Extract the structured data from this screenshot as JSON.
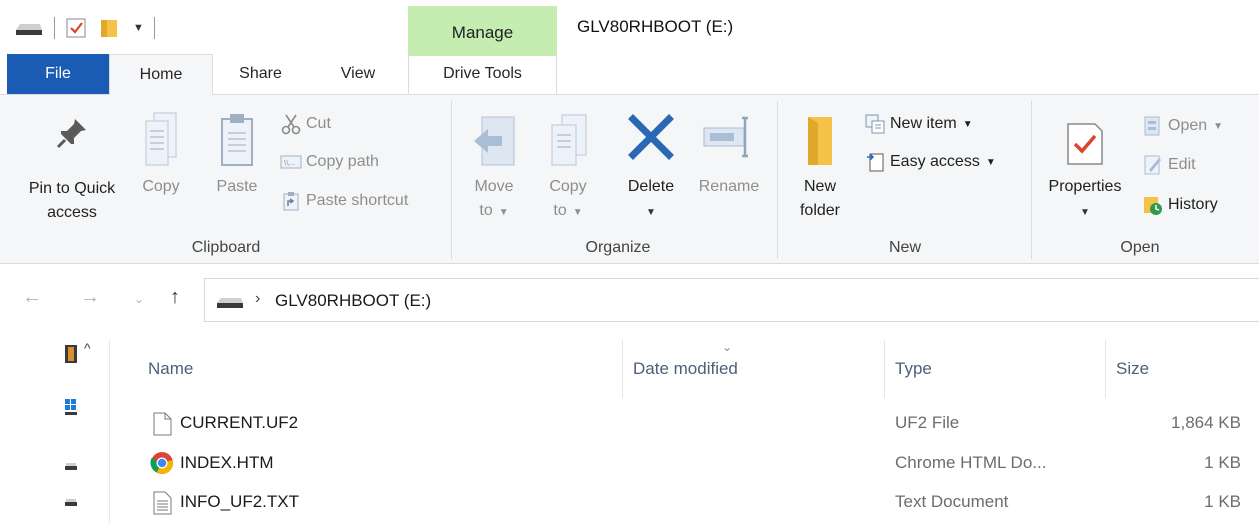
{
  "window": {
    "title": "GLV80RHBOOT (E:)",
    "contextual_tab_group": "Manage"
  },
  "tabs": {
    "file": "File",
    "home": "Home",
    "share": "Share",
    "view": "View",
    "drive_tools": "Drive Tools"
  },
  "ribbon": {
    "clipboard": {
      "label": "Clipboard",
      "pin_line1": "Pin to Quick",
      "pin_line2": "access",
      "copy": "Copy",
      "paste": "Paste",
      "cut": "Cut",
      "copy_path": "Copy path",
      "paste_shortcut": "Paste shortcut"
    },
    "organize": {
      "label": "Organize",
      "move_line1": "Move",
      "move_line2": "to",
      "copy_line1": "Copy",
      "copy_line2": "to",
      "delete": "Delete",
      "rename": "Rename"
    },
    "new": {
      "label": "New",
      "new_folder_line1": "New",
      "new_folder_line2": "folder",
      "new_item": "New item",
      "easy_access": "Easy access"
    },
    "open": {
      "label": "Open",
      "properties": "Properties",
      "open": "Open",
      "edit": "Edit",
      "history": "History"
    }
  },
  "address": {
    "path": "GLV80RHBOOT (E:)"
  },
  "columns": {
    "name": "Name",
    "date_modified": "Date modified",
    "type": "Type",
    "size": "Size"
  },
  "files": [
    {
      "name": "CURRENT.UF2",
      "type": "UF2 File",
      "size": "1,864 KB",
      "icon": "blank-file-icon"
    },
    {
      "name": "INDEX.HTM",
      "type": "Chrome HTML Do...",
      "size": "1 KB",
      "icon": "chrome-icon"
    },
    {
      "name": "INFO_UF2.TXT",
      "type": "Text Document",
      "size": "1 KB",
      "icon": "text-file-icon"
    }
  ],
  "colors": {
    "file_tab": "#1a5bb3",
    "manage_tab": "#c5ecb1",
    "ribbon_bg": "#f5f6f7",
    "delete_x": "#2a68b6",
    "folder": "#f3c247",
    "properties_check": "#d9462b"
  }
}
